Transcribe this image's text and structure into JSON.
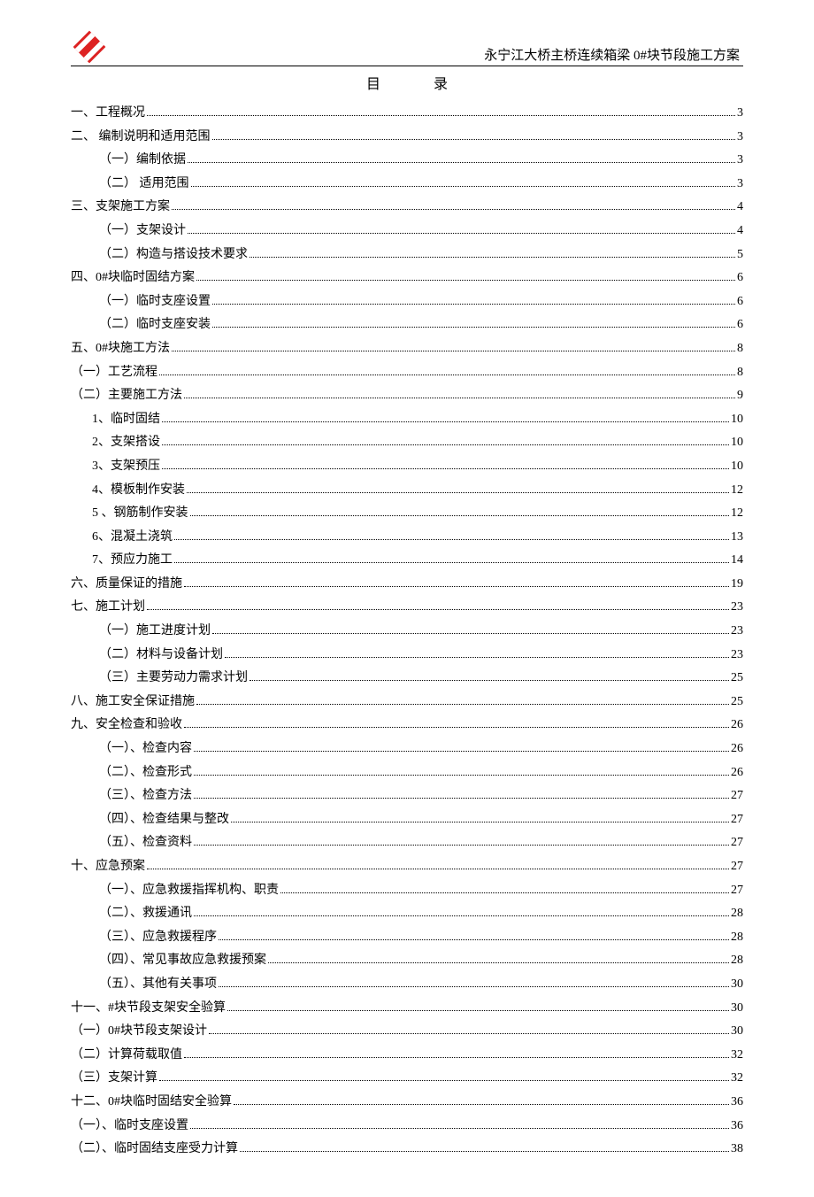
{
  "header": {
    "title": "永宁江大桥主桥连续箱梁 0#块节段施工方案"
  },
  "toc_title": "目录",
  "toc": [
    {
      "label": "一、工程概况",
      "page": "3",
      "indent": 0
    },
    {
      "label": "二、 编制说明和适用范围",
      "page": "3",
      "indent": 0
    },
    {
      "label": "（一）编制依据",
      "page": "3",
      "indent": 1
    },
    {
      "label": "（二） 适用范围",
      "page": "3",
      "indent": 1
    },
    {
      "label": "三、支架施工方案",
      "page": "4",
      "indent": 0
    },
    {
      "label": "（一）支架设计",
      "page": "4",
      "indent": 1
    },
    {
      "label": "（二）构造与搭设技术要求",
      "page": "5",
      "indent": 1
    },
    {
      "label": "四、0#块临时固结方案",
      "page": "6",
      "indent": 0
    },
    {
      "label": "（一）临时支座设置",
      "page": "6",
      "indent": 1
    },
    {
      "label": "（二）临时支座安装",
      "page": "6",
      "indent": 1
    },
    {
      "label": "五、0#块施工方法",
      "page": "8",
      "indent": 0
    },
    {
      "label": "（一）工艺流程",
      "page": "8",
      "indent": 0
    },
    {
      "label": "（二）主要施工方法",
      "page": "9",
      "indent": 0
    },
    {
      "label": "1、临时固结",
      "page": "10",
      "indent": 2
    },
    {
      "label": "2、支架搭设",
      "page": "10",
      "indent": 2
    },
    {
      "label": "3、支架预压",
      "page": "10",
      "indent": 2
    },
    {
      "label": "4、模板制作安装",
      "page": "12",
      "indent": 2
    },
    {
      "label": "5 、钢筋制作安装",
      "page": "12",
      "indent": 2
    },
    {
      "label": "6、混凝土浇筑",
      "page": "13",
      "indent": 2
    },
    {
      "label": "7、预应力施工",
      "page": "14",
      "indent": 2
    },
    {
      "label": "六、质量保证的措施",
      "page": "19",
      "indent": 0
    },
    {
      "label": "七、施工计划",
      "page": "23",
      "indent": 0
    },
    {
      "label": "（一）施工进度计划",
      "page": "23",
      "indent": 1
    },
    {
      "label": "（二）材料与设备计划",
      "page": "23",
      "indent": 1
    },
    {
      "label": "（三）主要劳动力需求计划",
      "page": "25",
      "indent": 1
    },
    {
      "label": "八、施工安全保证措施",
      "page": "25",
      "indent": 0
    },
    {
      "label": "九、安全检查和验收",
      "page": "26",
      "indent": 0
    },
    {
      "label": "（一）、检查内容",
      "page": "26",
      "indent": 1
    },
    {
      "label": "（二）、检查形式",
      "page": "26",
      "indent": 1
    },
    {
      "label": "（三）、检查方法",
      "page": "27",
      "indent": 1
    },
    {
      "label": "（四）、检查结果与整改",
      "page": "27",
      "indent": 1
    },
    {
      "label": "（五）、检查资料",
      "page": "27",
      "indent": 1
    },
    {
      "label": "十、应急预案",
      "page": "27",
      "indent": 0
    },
    {
      "label": "（一）、应急救援指挥机构、职责",
      "page": "27",
      "indent": 1
    },
    {
      "label": "（二）、救援通讯",
      "page": "28",
      "indent": 1
    },
    {
      "label": "（三）、应急救援程序",
      "page": "28",
      "indent": 1
    },
    {
      "label": "（四）、常见事故应急救援预案",
      "page": "28",
      "indent": 1
    },
    {
      "label": "（五）、其他有关事项",
      "page": "30",
      "indent": 1
    },
    {
      "label": "十一、#块节段支架安全验算",
      "page": "30",
      "indent": 0
    },
    {
      "label": "（一）0#块节段支架设计",
      "page": "30",
      "indent": 0
    },
    {
      "label": "（二）计算荷载取值",
      "page": "32",
      "indent": 0
    },
    {
      "label": "（三）支架计算",
      "page": "32",
      "indent": 0
    },
    {
      "label": "十二、0#块临时固结安全验算",
      "page": "36",
      "indent": 0
    },
    {
      "label": "（一）、临时支座设置",
      "page": "36",
      "indent": 0
    },
    {
      "label": "（二）、临时固结支座受力计算",
      "page": "38",
      "indent": 0
    }
  ]
}
